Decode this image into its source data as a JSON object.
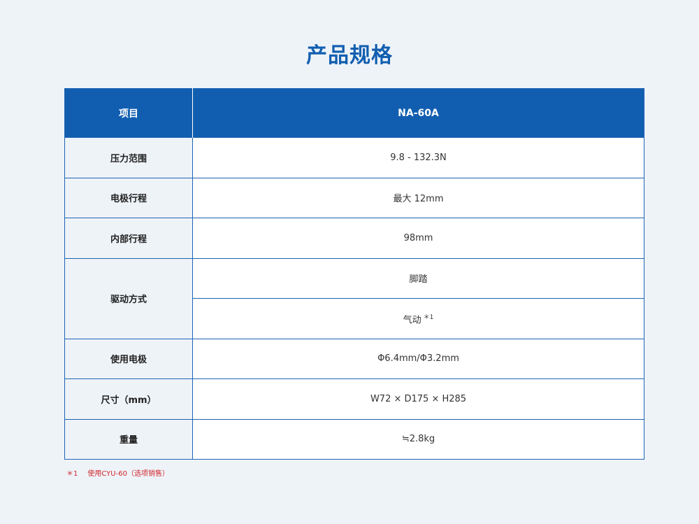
{
  "title": "产品规格",
  "table": {
    "header": {
      "item": "项目",
      "model": "NA-60A"
    },
    "rows": [
      {
        "label": "压力范围",
        "value": "9.8 - 132.3N"
      },
      {
        "label": "电极行程",
        "value": "最大 12mm"
      },
      {
        "label": "内部行程",
        "value": "98mm"
      },
      {
        "label": "驱动方式",
        "values": [
          "脚踏",
          "气动"
        ],
        "note_ref": "＊1"
      },
      {
        "label": "使用电极",
        "value": "Φ6.4mm/Φ3.2mm"
      },
      {
        "label": "尺寸（mm）",
        "value": "W72 × D175 × H285"
      },
      {
        "label": "重量",
        "value": "≒2.8kg"
      }
    ]
  },
  "footnote": {
    "mark": "＊1",
    "text": "使用CYU-60（选项销售）"
  },
  "colors": {
    "accent": "#115eb0",
    "note": "#d0262a",
    "background": "#eef3f8"
  }
}
